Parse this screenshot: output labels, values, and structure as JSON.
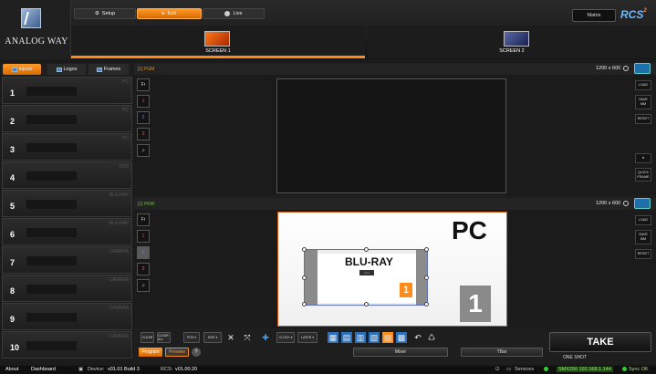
{
  "header": {
    "brand": "ANALOG WAY",
    "modes": {
      "setup": "Setup",
      "edit": "Edit",
      "live": "Live"
    },
    "matrix_label": "Matrix",
    "rcs_logo": "RCS",
    "rcs_badge": "2",
    "screens": [
      {
        "label": "SCREEN 1",
        "active": true
      },
      {
        "label": "SCREEN 2",
        "active": false
      }
    ]
  },
  "left_panel": {
    "tabs": {
      "inputs": "Inputs",
      "logos": "Logos",
      "frames": "Frames"
    },
    "inputs": [
      {
        "num": "1",
        "src": "PC"
      },
      {
        "num": "2",
        "src": "PC"
      },
      {
        "num": "3",
        "src": "PC"
      },
      {
        "num": "4",
        "src": "DVD"
      },
      {
        "num": "5",
        "src": "BLU-RAY"
      },
      {
        "num": "6",
        "src": "BLU-RAY"
      },
      {
        "num": "7",
        "src": "CAMERA"
      },
      {
        "num": "8",
        "src": "CAMERA"
      },
      {
        "num": "9",
        "src": "CAMERA"
      },
      {
        "num": "10",
        "src": "CAMERA"
      }
    ]
  },
  "program": {
    "title": "[1] PGM",
    "resolution": "1200 x 600"
  },
  "preview": {
    "title": "[1] PRW",
    "resolution": "1200 x 600",
    "bg_label": "PC",
    "layer_label": "BLU-RAY",
    "layer_sub": "▪ ▪ ▪",
    "layer_num": "1",
    "screen_num": "1"
  },
  "side_buttons": {
    "fr": "Fr",
    "b1": "1",
    "b2": "2",
    "b3": "3",
    "b4": "4"
  },
  "right_buttons": {
    "load": "LOAD",
    "save": "SAVE MM",
    "reset": "RESET",
    "quick": "QUICK FRAME"
  },
  "toolbar": {
    "clear": "CLEAR",
    "clear_all": "CLEAR ALL",
    "pos": "POS ▾",
    "size": "SIZE ▾",
    "clock": "CLOCK ▾",
    "layer": "LAYER ▾",
    "program": "Program",
    "preview": "Preview",
    "help": "?",
    "mixer": "Mixer",
    "tbar": "TBar",
    "take": "TAKE",
    "one_shot": "ONE SHOT"
  },
  "status": {
    "about": "About",
    "dashboard": "Dashboard",
    "device": "Device:",
    "device_version": "v01.01 Build 3",
    "rcs": "RCS:",
    "rcs_version": "v01.00.20",
    "services": "Services",
    "ip": "SMX250 192.168.1.144",
    "sync": "Sync OK"
  },
  "colors": {
    "accent": "#ff8c1a",
    "brand_blue": "#6cb8ff",
    "status_ok": "#38c838"
  }
}
